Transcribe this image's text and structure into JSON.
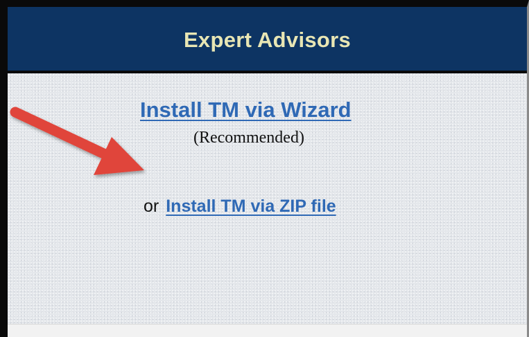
{
  "panel": {
    "title": "Expert Advisors",
    "wizard_link": "Install TM via Wizard",
    "wizard_note": "(Recommended)",
    "or_text": "or",
    "zip_link": "Install TM via ZIP file"
  },
  "colors": {
    "header_bg": "#0d3463",
    "header_text": "#e8e6b4",
    "link": "#2f69b5",
    "panel_bg": "#e4e7eb",
    "arrow": "#e0453a"
  },
  "icons": {
    "annotation_arrow": "red-arrow-icon"
  }
}
